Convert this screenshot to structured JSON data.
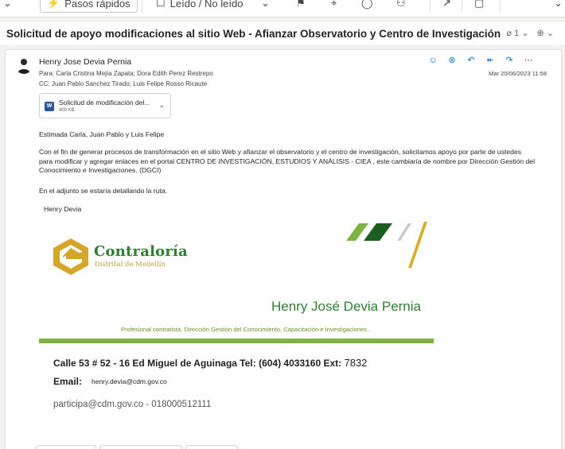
{
  "toolbar": {
    "quick_steps_label": "Pasos rápidos",
    "read_unread_label": "Leído / No leído"
  },
  "subject": {
    "title": "Solicitud de apoyo modificaciones al sitio Web - Afianzar Observatorio y Centro de Investigación",
    "attachment_count": "1",
    "zoom_icon": "zoom-icon"
  },
  "message": {
    "sender": "Henry Jose Devia Pernia",
    "to_label": "Para:",
    "to": "Carla Cristina Mejía Zapata;  Dora Edith Perez Restrepo",
    "cc_label": "CC:",
    "cc": "Juan Pablo Sanchez Tirado;  Luis Felipe Rosso Ricaute",
    "date": "Mar 20/06/2023 11:58",
    "attachment": {
      "name": "Solicitud de modificación del...",
      "size": "400 KB",
      "icon": "word-icon"
    },
    "body": {
      "greeting": "Estimada Carla, Juan Pablo y Luis Felipe",
      "paragraph1": "Con el fin de generar procesos de transformación en el sitio Web y afianzar el observatorio y el centro de investigación, solicitamos apoyo por parte de ustedes para modificar y agregar enlaces en el portal CENTRO DE INVESTIGACIÓN, ESTUDIOS Y ANÁLISIS - CIEA , este cambiaría de nombre por Dirección Gestión del Conocimiento e Investigaciones. (DGCI)",
      "paragraph2": "En el adjunto se estaría detallando la ruta.",
      "signoff": "Henry Devia"
    }
  },
  "signature": {
    "logo_text": "Contraloría",
    "logo_sub": "Distrital de Medellín",
    "name": "Henry José Devia Pernia",
    "role": "Profesional contratista. Dirección Gestión del Conocimiento, Capacitación e Investigaciones .",
    "address": "Calle 53 # 52 - 16 Ed Miguel de Aguinaga Tel: (604) 4033160 Ext:",
    "ext": "7832",
    "email_label": "Email:",
    "email": "henry.devia@cdm.gov.co",
    "contact": "participa@cdm.gov.co - 018000512111"
  },
  "colors": {
    "accent": "#0f6cbd",
    "brand_green": "#2e7d32",
    "brand_gold": "#d4b02a",
    "bar_green": "#7cb342"
  }
}
